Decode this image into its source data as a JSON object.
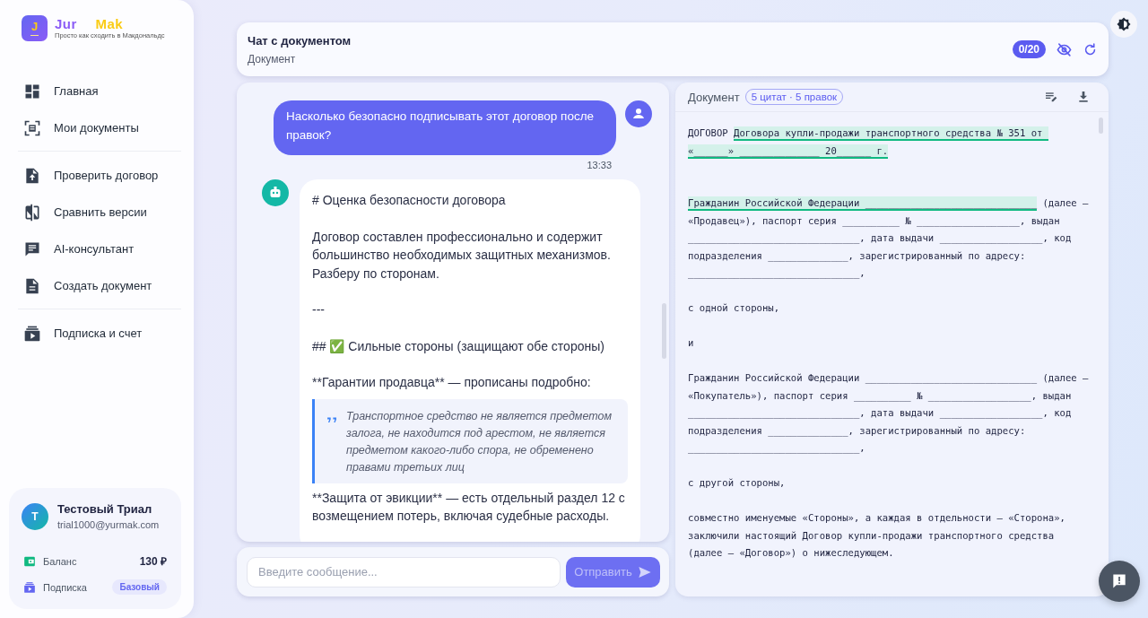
{
  "brand": {
    "logo_letter": "J",
    "name_first": "Jur",
    "name_second": "Mak",
    "tagline": "Просто как сходить в Макдональдс"
  },
  "sidebar": {
    "groups": [
      [
        {
          "label": "Главная",
          "selected": false
        },
        {
          "label": "Мои документы",
          "selected": false
        }
      ],
      [
        {
          "label": "Проверить договор",
          "selected": false
        },
        {
          "label": "Сравнить версии",
          "selected": false
        },
        {
          "label": "AI-консультант",
          "selected": false
        },
        {
          "label": "Создать документ",
          "selected": false
        }
      ],
      [
        {
          "label": "Подписка и счет",
          "selected": false
        }
      ]
    ]
  },
  "user": {
    "initial": "Т",
    "name": "Тестовый Триал",
    "email": "trial1000@yurmak.com",
    "balance_label": "Баланс",
    "balance": "130 ₽",
    "plan_label": "Подписка",
    "plan": "Базовый"
  },
  "header": {
    "title": "Чат с документом",
    "subtitle": "Документ",
    "counter": "0/20"
  },
  "chat": {
    "messages": [
      {
        "kind": "user",
        "text": "Насколько безопасно подписывать этот договор после правок?",
        "time": "13:33"
      },
      {
        "kind": "assistant",
        "blocks": [
          {
            "kind": "para",
            "text": "# Оценка безопасности договора"
          },
          {
            "kind": "para",
            "text": "Договор составлен профессионально и содержит большинство необходимых защитных механизмов. Разберу по сторонам."
          },
          {
            "kind": "para",
            "text": "---"
          },
          {
            "kind": "check",
            "text": "## ✅ Сильные стороны (защищают обе стороны)"
          },
          {
            "kind": "tight",
            "text": "**Гарантии продавца** — прописаны подробно:"
          },
          {
            "kind": "quote",
            "text": "Транспортное средство не является предметом залога, не находится под арестом, не является предметом какого-либо спора, не обременено правами третьих лиц"
          },
          {
            "kind": "para",
            "text": "**Защита от эвикции** — есть отдельный раздел 12 с возмещением потерь, включая судебные расходы."
          }
        ]
      }
    ]
  },
  "composer": {
    "placeholder": "Введите сообщение...",
    "send": "Отправить"
  },
  "document": {
    "title": "Документ",
    "badge": "5 цитат · 5 правок",
    "paragraphs": [
      [
        {
          "text": "ДОГОВОР ",
          "highlighted": false
        },
        {
          "text": "Договора купли-продажи транспортного средства № 351 от «______» ______________ 20______ г.",
          "highlighted": true
        }
      ],
      [
        {
          "text": "Гражданин Российской Федерации ______________________________",
          "highlighted": true
        },
        {
          "text": " (далее — «Продавец»), паспорт серия __________ № __________________, выдан ______________________________, дата выдачи __________________, код подразделения ______________, зарегистрированный по адресу: ______________________________,",
          "highlighted": false
        }
      ],
      [
        {
          "text": "с одной стороны,",
          "highlighted": false
        }
      ],
      [
        {
          "text": "и",
          "highlighted": false
        }
      ],
      [
        {
          "text": "Гражданин Российской Федерации ______________________________ (далее — «Покупатель»), паспорт серия __________ № __________________, выдан ______________________________, дата выдачи __________________, код подразделения ______________, зарегистрированный по адресу: ______________________________,",
          "highlighted": false
        }
      ],
      [
        {
          "text": "с другой стороны,",
          "highlighted": false
        }
      ],
      [
        {
          "text": "совместно именуемые «Стороны», а каждая в отдельности — «Сторона», заключили настоящий Договор купли-продажи транспортного средства (далее — «Договор») о нижеследующем.",
          "highlighted": false
        }
      ]
    ]
  }
}
